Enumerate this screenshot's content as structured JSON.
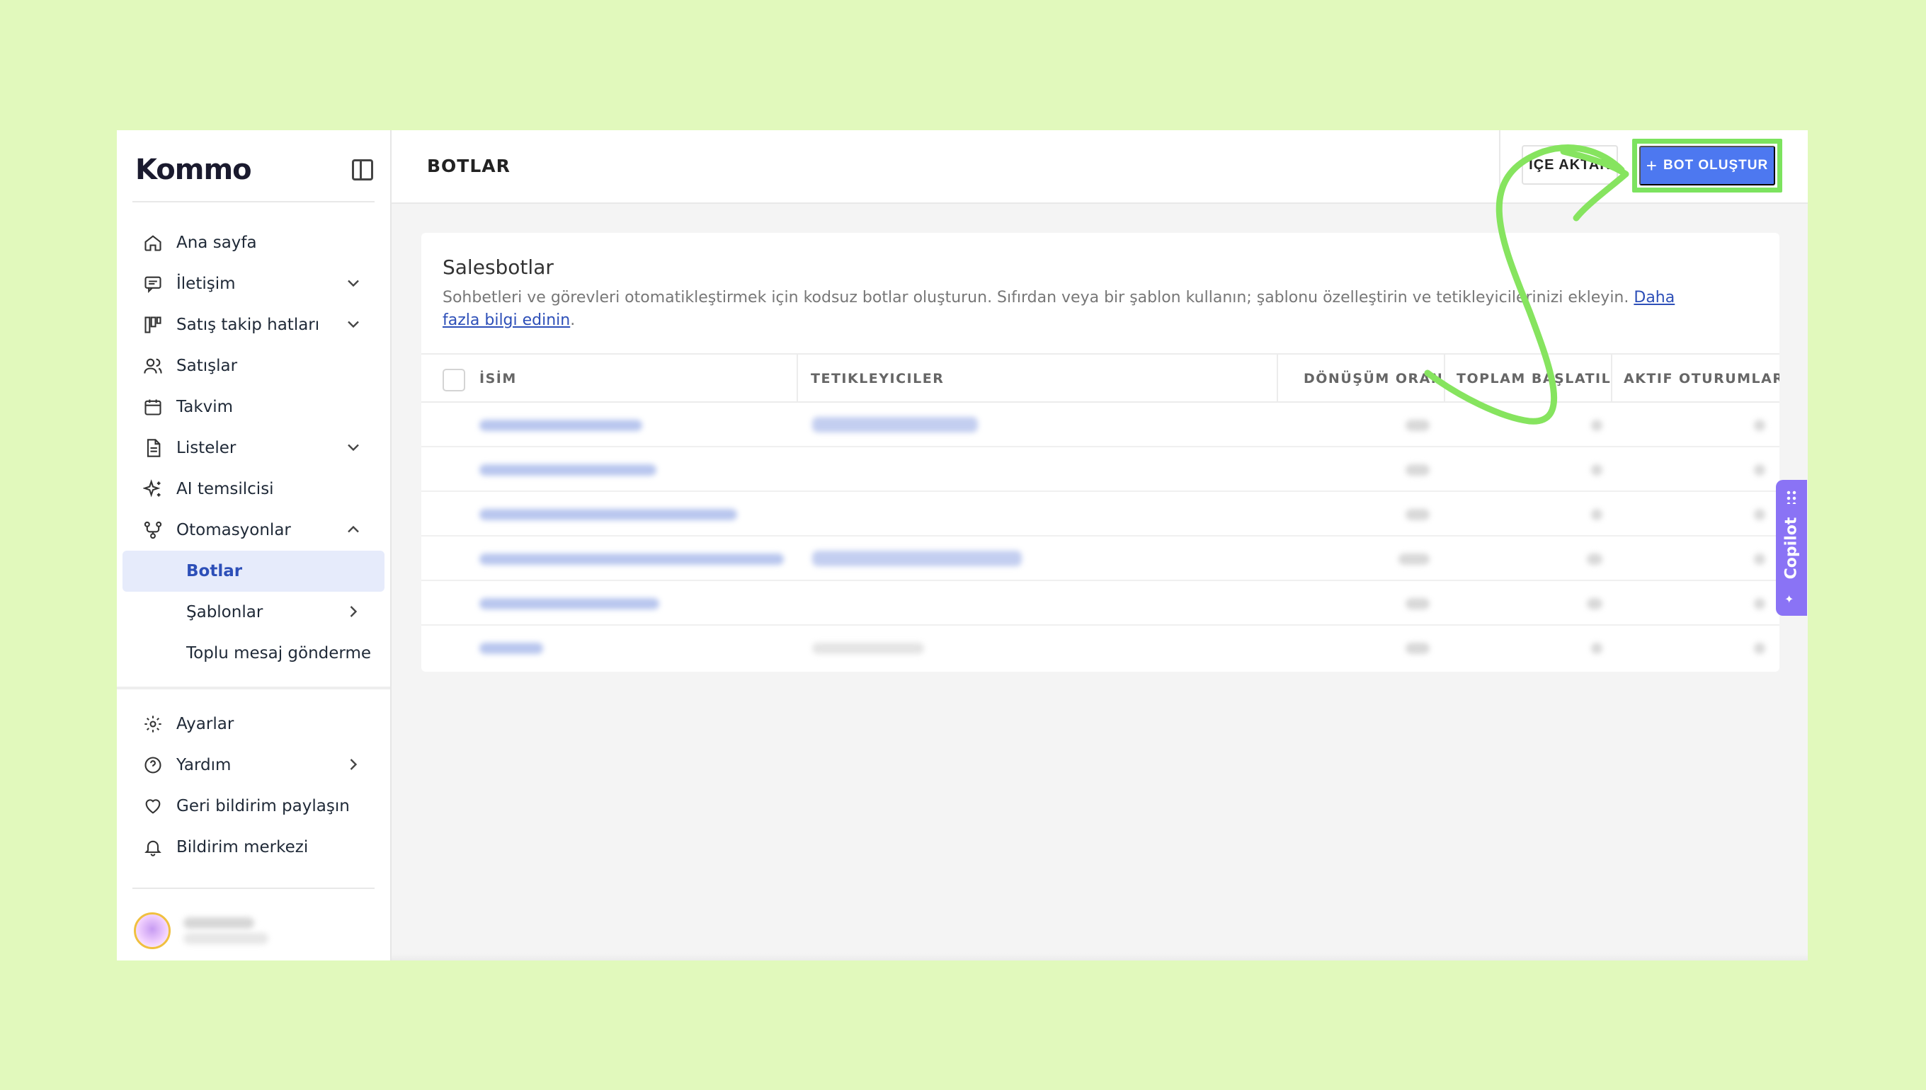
{
  "brand": {
    "logo_text": "Kommo",
    "accent": "#4d78f0",
    "highlight": "#7ce35f"
  },
  "sidebar": {
    "items": [
      {
        "label": "Ana sayfa",
        "icon": "home-icon",
        "chevron": ""
      },
      {
        "label": "İletişim",
        "icon": "chat-icon",
        "chevron": "down"
      },
      {
        "label": "Satış takip hatları",
        "icon": "pipeline-icon",
        "chevron": "down"
      },
      {
        "label": "Satışlar",
        "icon": "users-icon",
        "chevron": ""
      },
      {
        "label": "Takvim",
        "icon": "calendar-icon",
        "chevron": ""
      },
      {
        "label": "Listeler",
        "icon": "document-icon",
        "chevron": "down"
      },
      {
        "label": "AI temsilcisi",
        "icon": "sparkle-icon",
        "chevron": ""
      },
      {
        "label": "Otomasyonlar",
        "icon": "automation-icon",
        "chevron": "up"
      }
    ],
    "subitems": [
      {
        "label": "Botlar",
        "active": true
      },
      {
        "label": "Şablonlar",
        "chevron": "right"
      },
      {
        "label": "Toplu mesaj gönderme"
      }
    ],
    "bottom_items": [
      {
        "label": "Ayarlar",
        "icon": "gear-icon"
      },
      {
        "label": "Yardım",
        "icon": "help-icon",
        "chevron": "right"
      },
      {
        "label": "Geri bildirim paylaşın",
        "icon": "heart-icon"
      },
      {
        "label": "Bildirim merkezi",
        "icon": "bell-icon"
      }
    ]
  },
  "header": {
    "title": "BOTLAR",
    "import_label": "İÇE AKTAR",
    "create_label": "BOT OLUŞTUR",
    "create_plus": "+"
  },
  "card": {
    "title": "Salesbotlar",
    "description": "Sohbetleri ve görevleri otomatikleştirmek için kodsuz botlar oluşturun. Sıfırdan veya bir şablon kullanın; şablonu özelleştirin ve tetikleyicilerinizi ekleyin.",
    "link": "Daha fazla bilgi edinin",
    "link_suffix": "."
  },
  "table": {
    "columns": [
      "İSİM",
      "TETIKLEYICILER",
      "DÖNÜŞÜM ORANI",
      "TOPLAM BAŞLATILAN",
      "AKTIF OTURUMLAR"
    ],
    "row_count": 6
  },
  "copilot": {
    "label": "Copilot"
  }
}
